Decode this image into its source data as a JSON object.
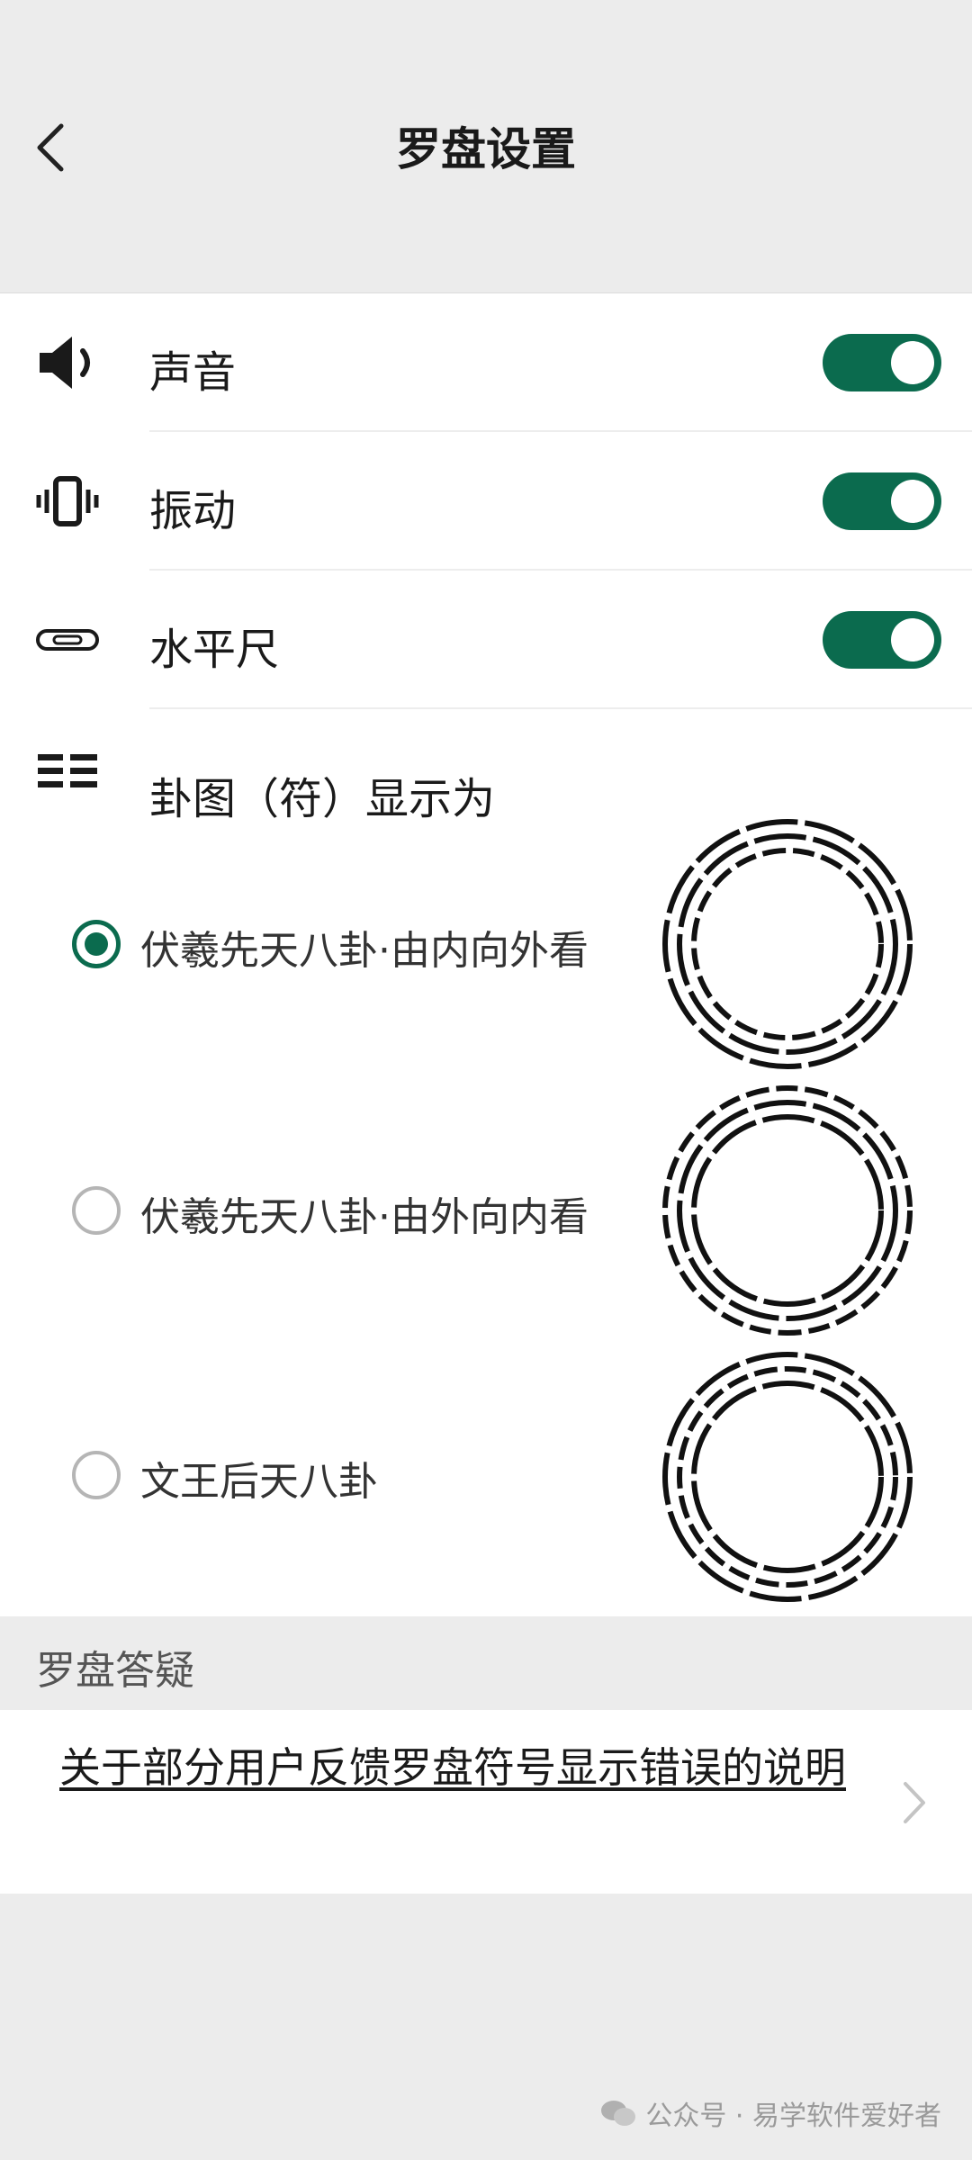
{
  "header": {
    "title": "罗盘设置"
  },
  "settings": {
    "toggles": [
      {
        "label": "声音",
        "icon": "speaker-icon",
        "on": true
      },
      {
        "label": "振动",
        "icon": "vibrate-icon",
        "on": true
      },
      {
        "label": "水平尺",
        "icon": "level-icon",
        "on": true
      }
    ],
    "trigram_section": {
      "label": "卦图（符）显示为",
      "icon": "list-icon",
      "options": [
        {
          "label": "伏羲先天八卦·由内向外看",
          "selected": true
        },
        {
          "label": "伏羲先天八卦·由外向内看",
          "selected": false
        },
        {
          "label": "文王后天八卦",
          "selected": false
        }
      ]
    }
  },
  "faq": {
    "section_label": "罗盘答疑",
    "link_text": "关于部分用户反馈罗盘符号显示错误的说明"
  },
  "watermark": {
    "text": "公众号 · 易学软件爱好者"
  },
  "colors": {
    "accent": "#0b6b4e",
    "background": "#ececec"
  }
}
